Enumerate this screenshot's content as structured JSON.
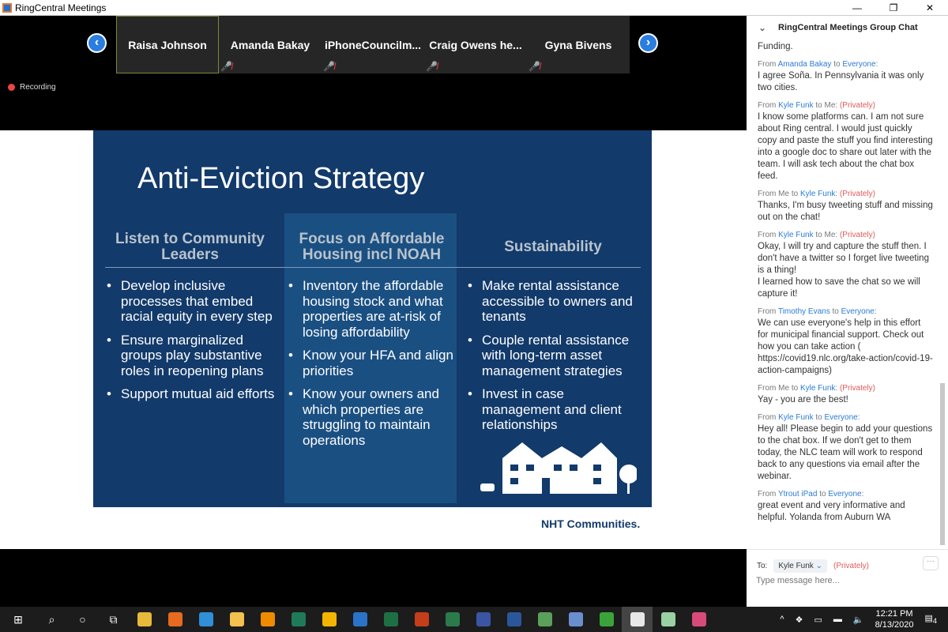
{
  "window": {
    "title": "RingCentral Meetings",
    "min": "—",
    "restore": "❐",
    "close": "✕"
  },
  "participants": [
    {
      "name": "Raisa Johnson",
      "muted": false,
      "active": true
    },
    {
      "name": "Amanda Bakay",
      "muted": true
    },
    {
      "name": "iPhoneCouncilm...",
      "muted": true
    },
    {
      "name": "Craig Owens he...",
      "muted": true
    },
    {
      "name": "Gyna Bivens",
      "muted": true
    }
  ],
  "nav": {
    "prev": "‹",
    "next": "›"
  },
  "recording": "Recording",
  "slide": {
    "title": "Anti-Eviction Strategy",
    "columns": [
      {
        "heading": "Listen to Community Leaders",
        "items": [
          "Develop inclusive processes that embed racial equity in every step",
          "Ensure marginalized groups play substantive roles in reopening plans",
          "Support mutual aid efforts"
        ]
      },
      {
        "heading": "Focus on Affordable Housing incl NOAH",
        "items": [
          "Inventory the affordable housing stock and what properties are at-risk of losing affordability",
          "Know your HFA and align priorities",
          "Know your owners and which properties are struggling to maintain operations"
        ]
      },
      {
        "heading": "Sustainability",
        "items": [
          "Make rental assistance accessible to owners and tenants",
          "Couple rental assistance with long-term asset management strategies",
          "Invest in case management and client relationships"
        ]
      }
    ],
    "logo": "NHT Communities."
  },
  "chat": {
    "title": "RingCentral Meetings Group Chat",
    "partial": "Funding.",
    "messages": [
      {
        "from": "Amanda Bakay",
        "to": "Everyone",
        "private": "",
        "text": "I agree Soña. In Pennsylvania it was only two cities."
      },
      {
        "from": "Kyle Funk",
        "to": "Me",
        "private": "(Privately)",
        "text": "I know some platforms can. I am not sure about Ring central. I would just quickly copy and paste the stuff you find interesting into a google doc to share out later with the team. I will ask tech about the chat box feed."
      },
      {
        "from": "Me",
        "to": "Kyle Funk",
        "private": "(Privately)",
        "text": "Thanks, I'm busy tweeting stuff and missing out on the chat!"
      },
      {
        "from": "Kyle Funk",
        "to": "Me",
        "private": "(Privately)",
        "text": "Okay, I will try and capture the stuff then. I don't have a twitter so I forget live tweeting is a thing!\nI learned how to save the chat so we will capture it!"
      },
      {
        "from": "Timothy Evans",
        "to": "Everyone",
        "private": "",
        "text": "We can use everyone's help in this effort for municipal financial support. Check out how you can take action ( https://covid19.nlc.org/take-action/covid-19-action-campaigns)"
      },
      {
        "from": "Me",
        "to": "Kyle Funk",
        "private": "(Privately)",
        "text": "Yay - you are the best!"
      },
      {
        "from": "Kyle Funk",
        "to": "Everyone",
        "private": "",
        "text": "Hey all! Please begin to add your questions to the chat box. If we don't get to them today, the NLC team will work to respond back to any questions via email after the webinar."
      },
      {
        "from": "Ytrout iPad",
        "to": "Everyone",
        "private": "",
        "text": "great event and very informative and helpful.  Yolanda from Auburn WA"
      }
    ],
    "labels": {
      "from": "From",
      "to": "to"
    },
    "compose": {
      "to_label": "To:",
      "recipient": "Kyle Funk",
      "privately": "(Privately)",
      "placeholder": "Type message here...",
      "more": "···"
    }
  },
  "taskbar": {
    "time": "12:21 PM",
    "date": "8/13/2020",
    "notifications": "4",
    "apps": [
      {
        "icon": "search-icon",
        "color": "#1c1c1c"
      },
      {
        "icon": "cortana-icon",
        "color": "#1c1c1c"
      },
      {
        "icon": "task-view-icon",
        "color": "#1c1c1c"
      },
      {
        "icon": "chrome-icon",
        "color": "#e8b93a"
      },
      {
        "icon": "firefox-icon",
        "color": "#e66a1f"
      },
      {
        "icon": "edge-icon",
        "color": "#2f8fd8"
      },
      {
        "icon": "file-explorer-icon",
        "color": "#f2c14e"
      },
      {
        "icon": "vlc-icon",
        "color": "#f08a00"
      },
      {
        "icon": "publisher-icon",
        "color": "#1f7a5a"
      },
      {
        "icon": "media-icon",
        "color": "#f2b400"
      },
      {
        "icon": "photos-icon",
        "color": "#2a73c8"
      },
      {
        "icon": "excel-icon",
        "color": "#1d7044"
      },
      {
        "icon": "powerpoint-icon",
        "color": "#c43e1c"
      },
      {
        "icon": "project-icon",
        "color": "#2b7a4b"
      },
      {
        "icon": "visio-icon",
        "color": "#3955a3"
      },
      {
        "icon": "word-icon",
        "color": "#2b579a"
      },
      {
        "icon": "network-icon",
        "color": "#5aa05a"
      },
      {
        "icon": "remote-desktop-icon",
        "color": "#6a8fcf"
      },
      {
        "icon": "camtasia-icon",
        "color": "#3aa43a"
      },
      {
        "icon": "ringcentral-icon",
        "color": "#e8e8e8"
      },
      {
        "icon": "paint-icon",
        "color": "#9ad1a2"
      },
      {
        "icon": "slack-icon",
        "color": "#d84a7a"
      }
    ]
  }
}
